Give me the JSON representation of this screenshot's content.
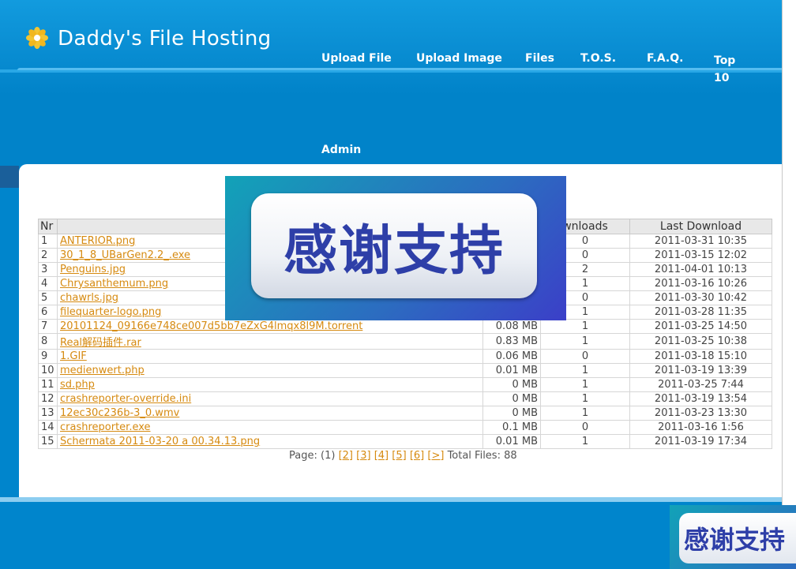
{
  "site": {
    "title": "Daddy's File Hosting"
  },
  "nav": [
    {
      "label": "Upload File"
    },
    {
      "label": "Upload Image"
    },
    {
      "label": "Files"
    },
    {
      "label": "T.O.S."
    },
    {
      "label": "F.A.Q."
    },
    {
      "label": "Top 10"
    },
    {
      "label": "Admin"
    }
  ],
  "table": {
    "headers": {
      "nr": "Nr",
      "downloads": "wnloads",
      "last": "Last Download"
    },
    "rows": [
      {
        "nr": "1",
        "name": "ANTERIOR.png",
        "size": "",
        "downloads": "0",
        "last": "2011-03-31 10:35"
      },
      {
        "nr": "2",
        "name": "30_1_8_UBarGen2.2_.exe",
        "size": "",
        "downloads": "0",
        "last": "2011-03-15 12:02"
      },
      {
        "nr": "3",
        "name": "Penguins.jpg",
        "size": "",
        "downloads": "2",
        "last": "2011-04-01 10:13"
      },
      {
        "nr": "4",
        "name": "Chrysanthemum.png",
        "size": "",
        "downloads": "1",
        "last": "2011-03-16 10:26"
      },
      {
        "nr": "5",
        "name": "chawrls.jpg",
        "size": "",
        "downloads": "0",
        "last": "2011-03-30 10:42"
      },
      {
        "nr": "6",
        "name": "filequarter-logo.png",
        "size": "",
        "downloads": "1",
        "last": "2011-03-28 11:35"
      },
      {
        "nr": "7",
        "name": "20101124_09166e748ce007d5bb7eZxG4lmqx8l9M.torrent",
        "size": "0.08 MB",
        "downloads": "1",
        "last": "2011-03-25 14:50"
      },
      {
        "nr": "8",
        "name": "Real解码插件.rar",
        "size": "0.83 MB",
        "downloads": "1",
        "last": "2011-03-25 10:38"
      },
      {
        "nr": "9",
        "name": "1.GIF",
        "size": "0.06 MB",
        "downloads": "0",
        "last": "2011-03-18 15:10"
      },
      {
        "nr": "10",
        "name": "medienwert.php",
        "size": "0.01 MB",
        "downloads": "1",
        "last": "2011-03-19 13:39"
      },
      {
        "nr": "11",
        "name": "sd.php",
        "size": "0 MB",
        "downloads": "1",
        "last": "2011-03-25 7:44"
      },
      {
        "nr": "12",
        "name": "crashreporter-override.ini",
        "size": "0 MB",
        "downloads": "1",
        "last": "2011-03-19 13:54"
      },
      {
        "nr": "13",
        "name": "12ec30c236b-3_0.wmv",
        "size": "0 MB",
        "downloads": "1",
        "last": "2011-03-23 13:30"
      },
      {
        "nr": "14",
        "name": "crashreporter.exe",
        "size": "0.1 MB",
        "downloads": "0",
        "last": "2011-03-16 1:56"
      },
      {
        "nr": "15",
        "name": "Schermata 2011-03-20 a 00.34.13.png",
        "size": "0.01 MB",
        "downloads": "1",
        "last": "2011-03-19 17:34"
      }
    ]
  },
  "pager": {
    "label": "Page:",
    "current": "(1)",
    "pages": [
      "[2]",
      "[3]",
      "[4]",
      "[5]",
      "[6]",
      "[>]"
    ],
    "total": "Total Files: 88"
  },
  "banner": {
    "text": "感谢支持"
  },
  "banner_small": {
    "text": "感谢支持"
  }
}
